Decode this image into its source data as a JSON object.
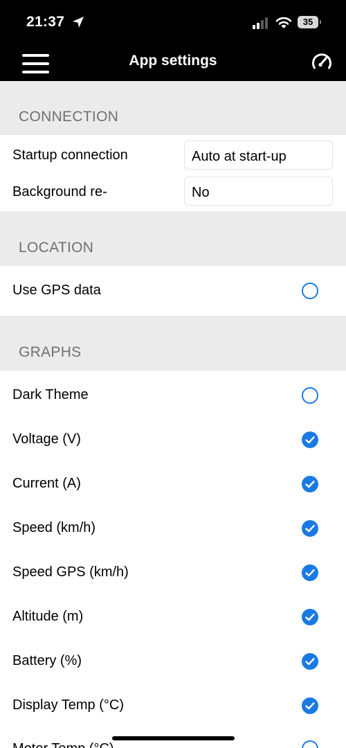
{
  "status_bar": {
    "time": "21:37",
    "battery_level": "35"
  },
  "nav": {
    "title": "App settings"
  },
  "sections": {
    "connection": {
      "header": "CONNECTION",
      "startup_label": "Startup connection",
      "startup_value": "Auto at start-up",
      "background_label": "Background re-",
      "background_value": "No"
    },
    "location": {
      "header": "LOCATION",
      "gps_label": "Use GPS data",
      "gps_checked": false
    },
    "graphs": {
      "header": "GRAPHS",
      "items": [
        {
          "label": "Dark Theme",
          "checked": false
        },
        {
          "label": "Voltage (V)",
          "checked": true
        },
        {
          "label": "Current (A)",
          "checked": true
        },
        {
          "label": "Speed (km/h)",
          "checked": true
        },
        {
          "label": "Speed GPS (km/h)",
          "checked": true
        },
        {
          "label": "Altitude (m)",
          "checked": true
        },
        {
          "label": "Battery (%)",
          "checked": true
        },
        {
          "label": "Display Temp (°C)",
          "checked": true
        },
        {
          "label": "Motor Temp (°C)",
          "checked": false
        }
      ]
    }
  },
  "colors": {
    "accent": "#1a7ae3",
    "section_bg": "#ebebeb",
    "header_text": "#707070",
    "bar_bg": "#000000"
  }
}
